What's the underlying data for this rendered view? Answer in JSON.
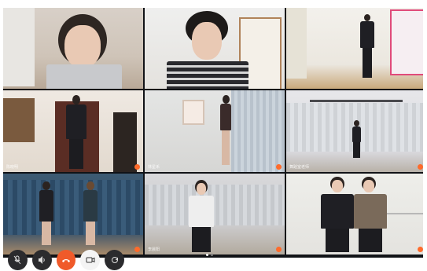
{
  "participants": [
    {
      "label": ""
    },
    {
      "label": ""
    },
    {
      "label": ""
    },
    {
      "label": "陈晓明"
    },
    {
      "label": "林星禾"
    },
    {
      "label": "舞蹈室老师"
    },
    {
      "label": ""
    },
    {
      "label": "李晨阳"
    },
    {
      "label": ""
    }
  ],
  "controls": [
    {
      "name": "mute",
      "icon": "microphone-off-icon"
    },
    {
      "name": "speaker",
      "icon": "speaker-icon"
    },
    {
      "name": "hang-up",
      "icon": "phone-hangup-icon"
    },
    {
      "name": "camera",
      "icon": "camera-icon"
    },
    {
      "name": "switch-camera",
      "icon": "switch-camera-icon"
    }
  ],
  "pager": {
    "pages": 2,
    "current": 1
  },
  "colors": {
    "hangup": "#f05a2a",
    "mic_badge": "#ff6b2b",
    "background": "#111317"
  }
}
